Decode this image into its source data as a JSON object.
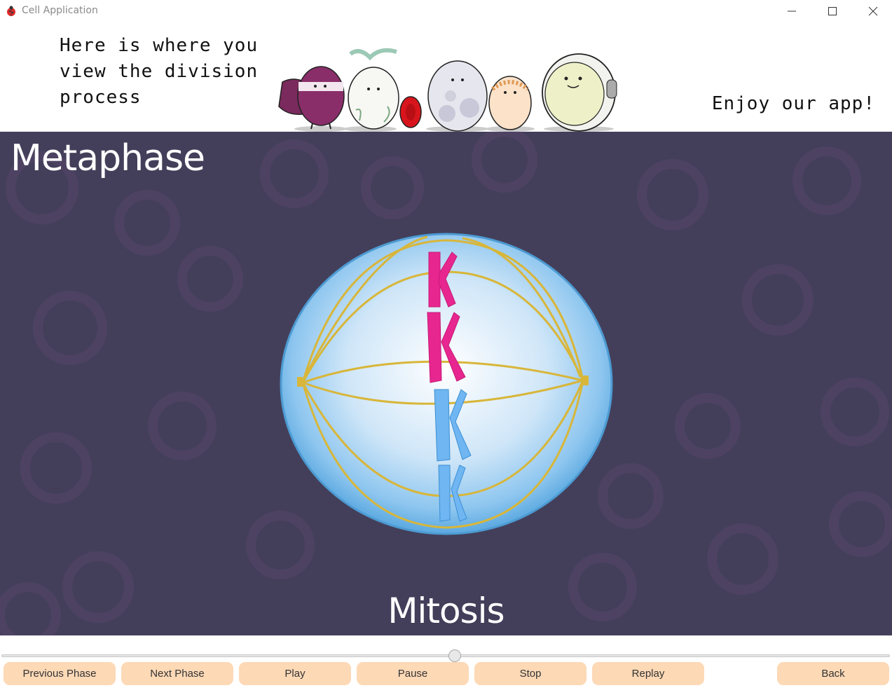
{
  "window": {
    "title": "Cell Application",
    "controls": [
      "minimize-icon",
      "maximize-icon",
      "close-icon"
    ],
    "app_icon": "ladybug-icon"
  },
  "header": {
    "intro_text": "Here is where you view the division process",
    "enjoy_text": "Enjoy our app!"
  },
  "video": {
    "phase_title": "Metaphase",
    "process_title": "Mitosis",
    "background_color": "#433f5a"
  },
  "playback": {
    "progress_fraction": 0.51
  },
  "buttons": {
    "previous_phase": "Previous Phase",
    "next_phase": "Next Phase",
    "play": "Play",
    "pause": "Pause",
    "stop": "Stop",
    "replay": "Replay",
    "back": "Back"
  },
  "colors": {
    "button_bg": "#fdd9b6",
    "chromosome_pink": "#e8268f",
    "chromosome_blue": "#6fb6f2",
    "cell_blue": "#6ab3e6"
  }
}
